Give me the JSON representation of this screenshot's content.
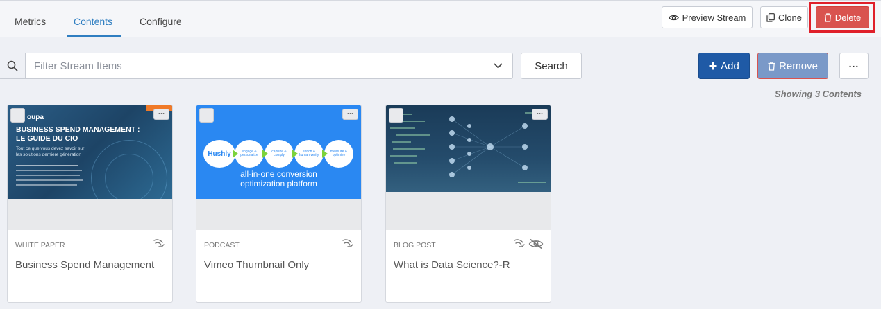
{
  "tabs": [
    {
      "label": "Metrics",
      "active": false
    },
    {
      "label": "Contents",
      "active": true
    },
    {
      "label": "Configure",
      "active": false
    }
  ],
  "header_actions": {
    "preview": "Preview Stream",
    "clone": "Clone",
    "delete": "Delete"
  },
  "filter": {
    "placeholder": "Filter Stream Items",
    "value": ""
  },
  "actions": {
    "search": "Search",
    "add": "Add",
    "remove": "Remove",
    "more": "..."
  },
  "showing": "Showing 3 Contents",
  "cards": [
    {
      "type": "WHITE PAPER",
      "title": "Business Spend Management",
      "menu": "...",
      "thumb": {
        "ribbon": "",
        "brand": "oupa",
        "heading1": "BUSINESS SPEND MANAGEMENT :",
        "heading2": "LE GUIDE DU CIO",
        "sub1": "Tout ce que vous devez savoir sur",
        "sub2": "les solutions dernière génération"
      }
    },
    {
      "type": "PODCAST",
      "title": "Vimeo Thumbnail Only",
      "menu": "...",
      "thumb": {
        "logo": "Hushly",
        "steps": [
          "engage & personalize",
          "capture & comply",
          "enrich & human verify",
          "measure & optimize"
        ],
        "tagline1": "all-in-one conversion",
        "tagline2": "optimization platform"
      }
    },
    {
      "type": "BLOG POST",
      "title": "What is Data Science?-R",
      "menu": "..."
    }
  ],
  "colors": {
    "accent": "#2f7ec1",
    "delete": "#d9534f",
    "add": "#1f5aa6",
    "remove": "#7a99c8",
    "highlight": "#e0202a"
  }
}
